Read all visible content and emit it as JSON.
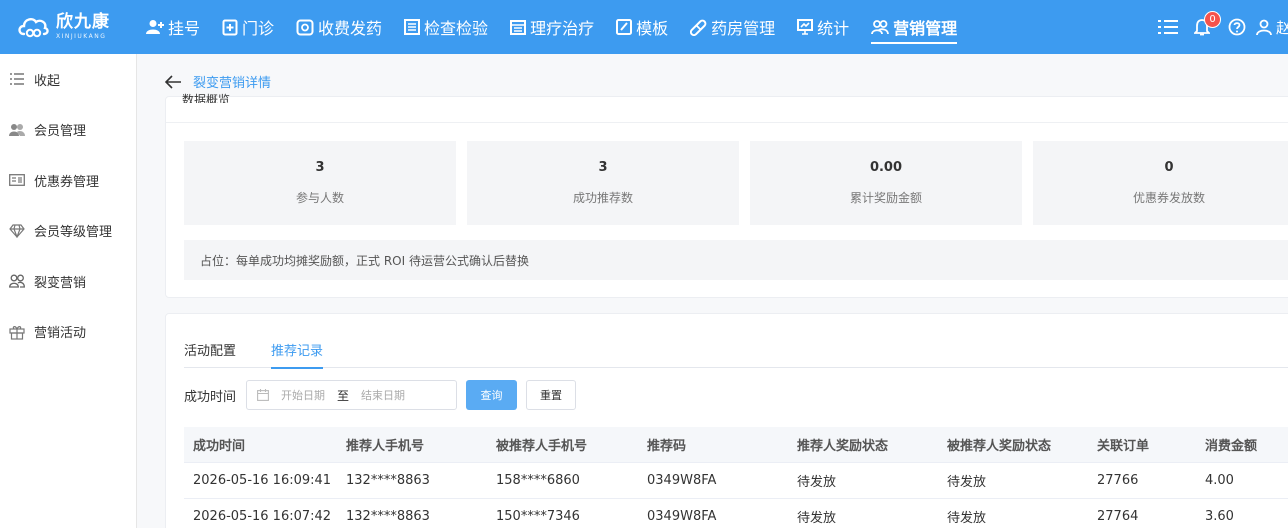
{
  "brand": {
    "name_cn": "欣九康",
    "name_en": "XINJIUKANG",
    "accent": "#3d9bf0"
  },
  "nav": {
    "items": [
      {
        "label": "挂号",
        "icon": "user-plus-icon"
      },
      {
        "label": "门诊",
        "icon": "clipboard-plus-icon"
      },
      {
        "label": "收费发药",
        "icon": "money-icon"
      },
      {
        "label": "检查检验",
        "icon": "report-icon"
      },
      {
        "label": "理疗治疗",
        "icon": "calendar-icon"
      },
      {
        "label": "模板",
        "icon": "edit-icon"
      },
      {
        "label": "药房管理",
        "icon": "pill-icon"
      },
      {
        "label": "统计",
        "icon": "chart-icon"
      },
      {
        "label": "营销管理",
        "icon": "users-icon"
      }
    ],
    "active_index": 8,
    "notification_count": "0",
    "user_initial": "赵"
  },
  "sidebar": {
    "collapse_label": "收起",
    "items": [
      {
        "label": "会员管理",
        "icon": "members-icon"
      },
      {
        "label": "优惠券管理",
        "icon": "coupon-icon"
      },
      {
        "label": "会员等级管理",
        "icon": "diamond-icon"
      },
      {
        "label": "裂变营销",
        "icon": "fission-icon"
      },
      {
        "label": "营销活动",
        "icon": "gift-icon"
      }
    ]
  },
  "page": {
    "title": "裂变营销详情",
    "section_title": "数据概览"
  },
  "stats": [
    {
      "value": "3",
      "label": "参与人数"
    },
    {
      "value": "3",
      "label": "成功推荐数"
    },
    {
      "value": "0.00",
      "label": "累计奖励金额"
    },
    {
      "value": "0",
      "label": "优惠券发放数"
    }
  ],
  "note": "占位：每单成功均摊奖励额，正式 ROI 待运营公式确认后替换",
  "tabs": [
    {
      "label": "活动配置"
    },
    {
      "label": "推荐记录"
    }
  ],
  "active_tab": 1,
  "filter": {
    "label": "成功时间",
    "start_placeholder": "开始日期",
    "separator": "至",
    "end_placeholder": "结束日期",
    "query_label": "查询",
    "reset_label": "重置"
  },
  "table": {
    "columns": [
      "成功时间",
      "推荐人手机号",
      "被推荐人手机号",
      "推荐码",
      "推荐人奖励状态",
      "被推荐人奖励状态",
      "关联订单",
      "消费金额"
    ],
    "rows": [
      [
        "2026-05-16 16:09:41",
        "132****8863",
        "158****6860",
        "0349W8FA",
        "待发放",
        "待发放",
        "27766",
        "4.00"
      ],
      [
        "2026-05-16 16:07:42",
        "132****8863",
        "150****7346",
        "0349W8FA",
        "待发放",
        "待发放",
        "27764",
        "3.60"
      ]
    ]
  }
}
